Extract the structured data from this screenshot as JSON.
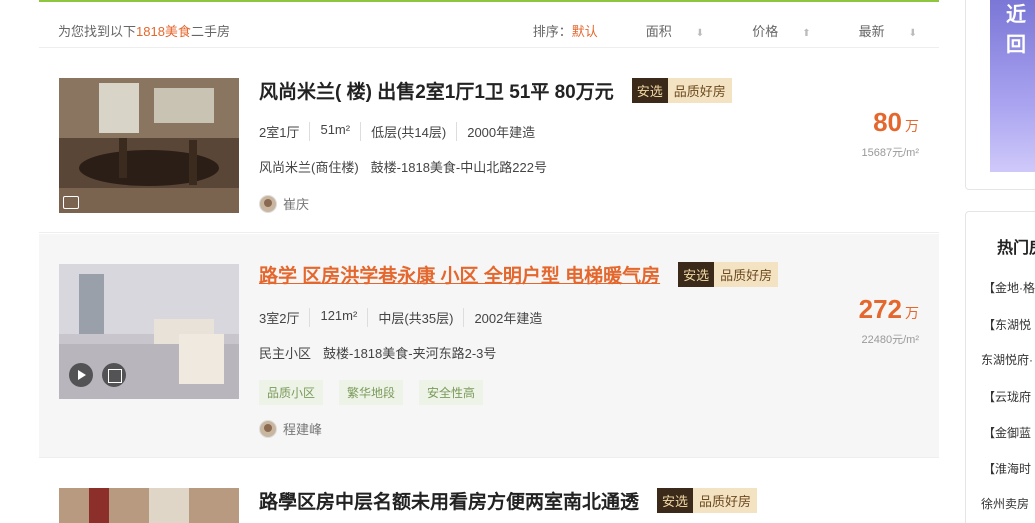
{
  "result_bar": {
    "prefix": "为您找到以下",
    "keyword": "1818美食",
    "suffix": "二手房"
  },
  "sort": {
    "label": "排序：",
    "default": "默认",
    "area": "面积",
    "price": "价格",
    "latest": "最新"
  },
  "listings": [
    {
      "title": "风尚米兰( 楼) 出售2室1厅1卫 51平 80万元",
      "badge_a": "安选",
      "badge_b": "品质好房",
      "meta": [
        "2室1厅",
        "51m²",
        "低层(共14层)",
        "2000年建造"
      ],
      "community": "风尚米兰(商住楼)",
      "location": "鼓楼-1818美食-中山北路222号",
      "tags": [],
      "agent": "崔庆",
      "price": "80",
      "price_unit": "万",
      "unit_price": "15687元/m²"
    },
    {
      "title": "路学 区房洪学巷永康 小区 全明户型 电梯暖气房",
      "badge_a": "安选",
      "badge_b": "品质好房",
      "meta": [
        "3室2厅",
        "121m²",
        "中层(共35层)",
        "2002年建造"
      ],
      "community": "民主小区",
      "location": "鼓楼-1818美食-夹河东路2-3号",
      "tags": [
        "品质小区",
        "繁华地段",
        "安全性高"
      ],
      "agent": "程建峰",
      "price": "272",
      "price_unit": "万",
      "unit_price": "22480元/m²"
    },
    {
      "title": "路學区房中层名额未用看房方便两室南北通透",
      "badge_a": "安选",
      "badge_b": "品质好房"
    }
  ],
  "ad": {
    "line1": "近",
    "line2": "回"
  },
  "hot": {
    "title": "热门房",
    "items": [
      "【金地·格",
      "【东湖悦",
      "东湖悦府·",
      "【云珑府",
      "【金御蓝",
      "【淮海时",
      "徐州卖房"
    ]
  },
  "colors": {
    "accent": "#e4672e",
    "top_rule": "#8ec63f",
    "badge_dark": "#3b2a1a",
    "badge_light": "#f4e3c3"
  }
}
